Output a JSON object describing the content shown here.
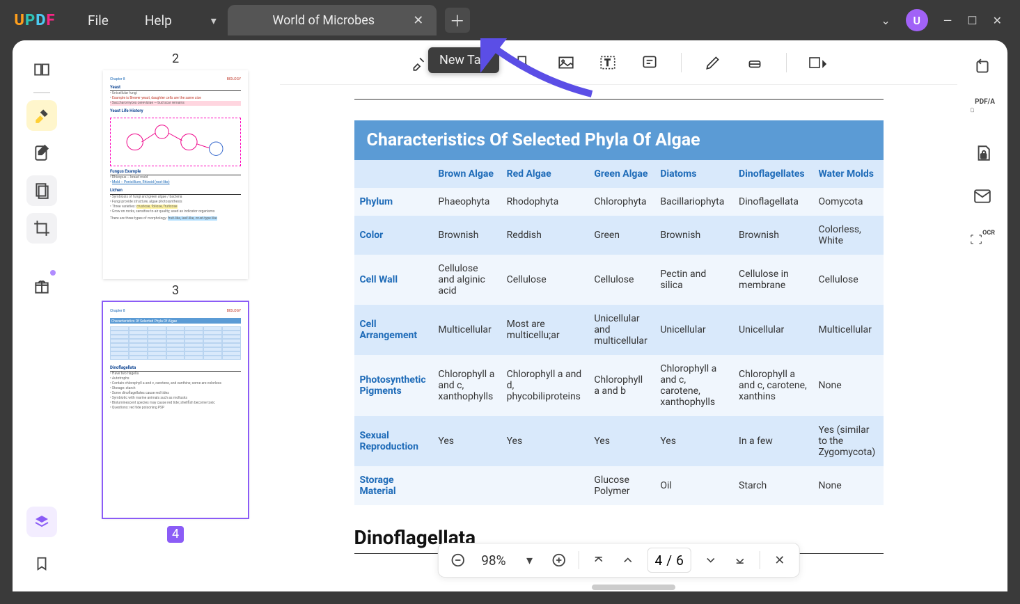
{
  "app": {
    "logo": "UPDF",
    "avatar_initial": "U"
  },
  "menu": {
    "file": "File",
    "help": "Help"
  },
  "tabs": {
    "active_title": "World of Microbes",
    "newtab_tooltip": "New Tab"
  },
  "toolbar": {
    "highlighter": "highlighter",
    "eraser": "eraser",
    "textbox": "textbox",
    "text": "text",
    "note": "note",
    "pen": "pen",
    "stamp": "stamp",
    "shape": "shape"
  },
  "paging": {
    "zoom": "98%",
    "current": "4",
    "sep": "/",
    "total": "6"
  },
  "thumbs": {
    "p2": "2",
    "p3": "3",
    "p4": "4"
  },
  "doc": {
    "table_title": "Characteristics Of Selected Phyla Of Algae",
    "cols": [
      "Brown Algae",
      "Red Algae",
      "Green Algae",
      "Diatoms",
      "Dinoflagellates",
      "Water Molds"
    ],
    "rows": [
      {
        "label": "Phylum",
        "cells": [
          "Phaeophyta",
          "Rhodophyta",
          "Chlorophyta",
          "Bacillariophyta",
          "Dinoflagellata",
          "Oomycota"
        ]
      },
      {
        "label": "Color",
        "cells": [
          "Brownish",
          "Reddish",
          "Green",
          "Brownish",
          "Brownish",
          "Colorless, White"
        ]
      },
      {
        "label": "Cell Wall",
        "cells": [
          "Cellulose and alginic acid",
          "Cellulose",
          "Cellulose",
          "Pectin and silica",
          "Cellulose in membrane",
          "Cellulose"
        ]
      },
      {
        "label": "Cell Arrangement",
        "cells": [
          "Multicellular",
          "Most are multicellu;ar",
          "Unicellular and multicellular",
          "Unicellular",
          "Unicellular",
          "Multicellular"
        ]
      },
      {
        "label": "Photosynthetic Pigments",
        "cells": [
          "Chlorophyll a and c, xanthophylls",
          "Chlorophyll a and d, phycobiliproteins",
          "Chlorophyll a and b",
          "Chlorophyll a and c, carotene, xanthophylls",
          "Chlorophyll a and c, carotene, xanthins",
          "None"
        ]
      },
      {
        "label": "Sexual Reproduction",
        "cells": [
          "Yes",
          "Yes",
          "Yes",
          "Yes",
          "In a few",
          "Yes (similar to the Zygomycota)"
        ]
      },
      {
        "label": "Storage Material",
        "cells": [
          "",
          "",
          "Glucose Polymer",
          "Oil",
          "Starch",
          "None"
        ]
      }
    ],
    "next_heading": "Dinoflagellata"
  }
}
